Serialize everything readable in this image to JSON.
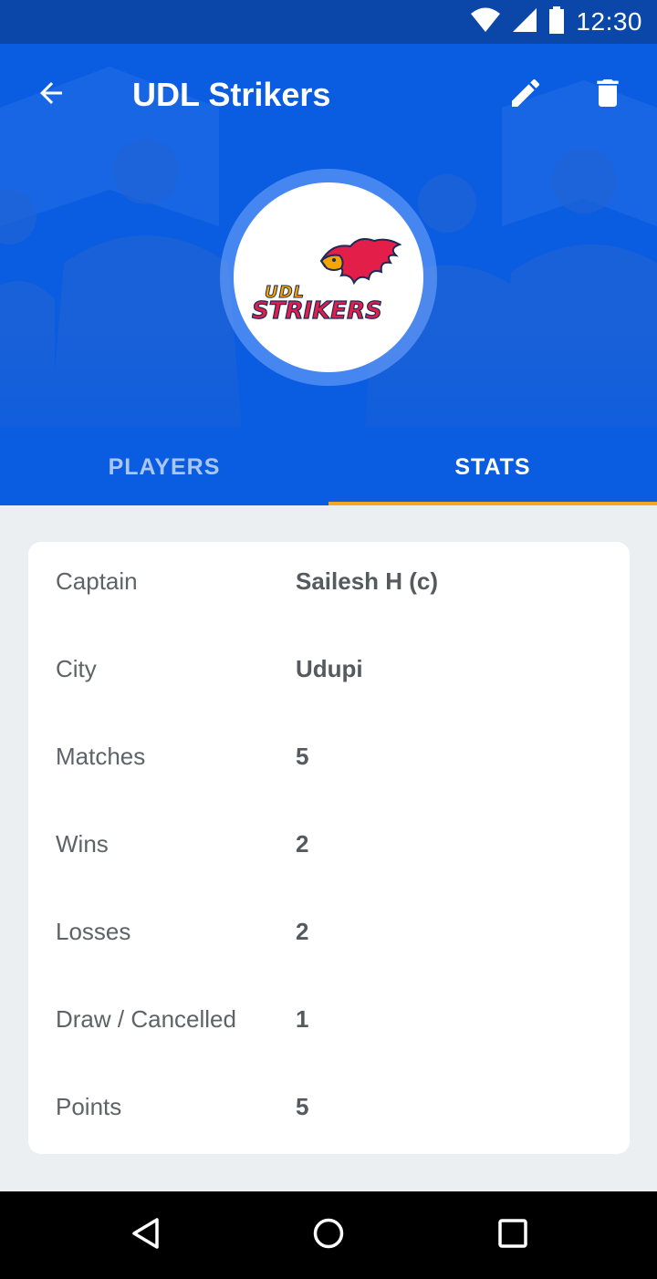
{
  "status_bar": {
    "time": "12:30",
    "icons": [
      "wifi-icon",
      "signal-icon",
      "battery-icon"
    ]
  },
  "toolbar": {
    "title": "UDL Strikers",
    "back_icon": "arrow-back-icon",
    "edit_icon": "pencil-icon",
    "delete_icon": "trash-icon"
  },
  "team_logo": {
    "line1": "UDL",
    "line2": "STRIKERS"
  },
  "tabs": [
    {
      "label": "PLAYERS",
      "active": false
    },
    {
      "label": "STATS",
      "active": true
    }
  ],
  "stats": [
    {
      "label": "Captain",
      "value": "Sailesh H (c)"
    },
    {
      "label": "City",
      "value": "Udupi"
    },
    {
      "label": "Matches",
      "value": "5"
    },
    {
      "label": "Wins",
      "value": "2"
    },
    {
      "label": "Losses",
      "value": "2"
    },
    {
      "label": "Draw / Cancelled",
      "value": "1"
    },
    {
      "label": "Points",
      "value": "5"
    }
  ],
  "nav_bar": {
    "icons": [
      "back-triangle-icon",
      "home-circle-icon",
      "recents-square-icon"
    ]
  },
  "colors": {
    "header_blue": "#0a5ce0",
    "status_bar": "#0b47a8",
    "tab_indicator": "#f5a623",
    "page_bg": "#eceff1"
  }
}
